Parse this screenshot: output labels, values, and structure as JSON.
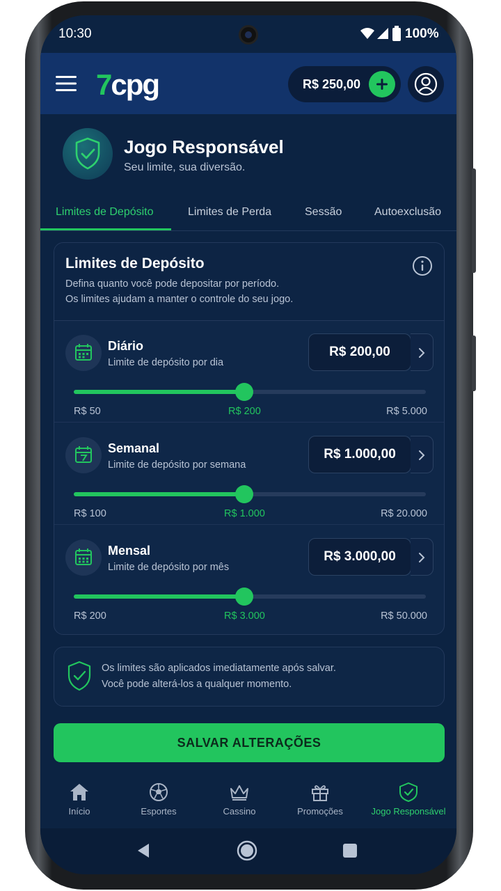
{
  "status": {
    "time": "10:30",
    "battery": "100%"
  },
  "header": {
    "logo_num": "7",
    "logo_text": "cpg",
    "balance": "R$ 250,00"
  },
  "page": {
    "title": "Jogo Responsável",
    "subtitle": "Seu limite, sua diversão."
  },
  "tabs": [
    {
      "label": "Limites de Depósito"
    },
    {
      "label": "Limites de Perda"
    },
    {
      "label": "Sessão"
    },
    {
      "label": "Autoexclusão"
    }
  ],
  "card": {
    "title": "Limites de Depósito",
    "desc_line1": "Defina quanto você pode depositar por período.",
    "desc_line2": "Os limites ajudam a manter o controle do seu jogo."
  },
  "limits": [
    {
      "title": "Diário",
      "subtitle": "Limite de depósito por dia",
      "amount": "R$ 200,00",
      "min": "R$ 50",
      "current": "R$ 200",
      "max": "R$ 5.000",
      "fill_fraction": 0.485,
      "icon": "calendar-icon"
    },
    {
      "title": "Semanal",
      "subtitle": "Limite de depósito por semana",
      "amount": "R$ 1.000,00",
      "min": "R$ 100",
      "current": "R$ 1.000",
      "max": "R$ 20.000",
      "fill_fraction": 0.485,
      "icon": "calendar-week-icon"
    },
    {
      "title": "Mensal",
      "subtitle": "Limite de depósito por mês",
      "amount": "R$ 3.000,00",
      "min": "R$ 200",
      "current": "R$ 3.000",
      "max": "R$ 50.000",
      "fill_fraction": 0.485,
      "icon": "calendar-month-icon"
    }
  ],
  "note": {
    "line1": "Os limites são aplicados imediatamente após salvar.",
    "line2": "Você pode alterá-los a qualquer momento."
  },
  "save_label": "SALVAR ALTERAÇÕES",
  "nav": [
    {
      "label": "Início",
      "icon": "home-icon"
    },
    {
      "label": "Esportes",
      "icon": "soccer-ball-icon"
    },
    {
      "label": "Cassino",
      "icon": "crown-icon"
    },
    {
      "label": "Promoções",
      "icon": "gift-icon"
    },
    {
      "label": "Jogo Responsável",
      "icon": "shield-check-icon"
    }
  ],
  "colors": {
    "accent": "#22c55e",
    "background": "#0c2342",
    "header": "#12336a"
  }
}
